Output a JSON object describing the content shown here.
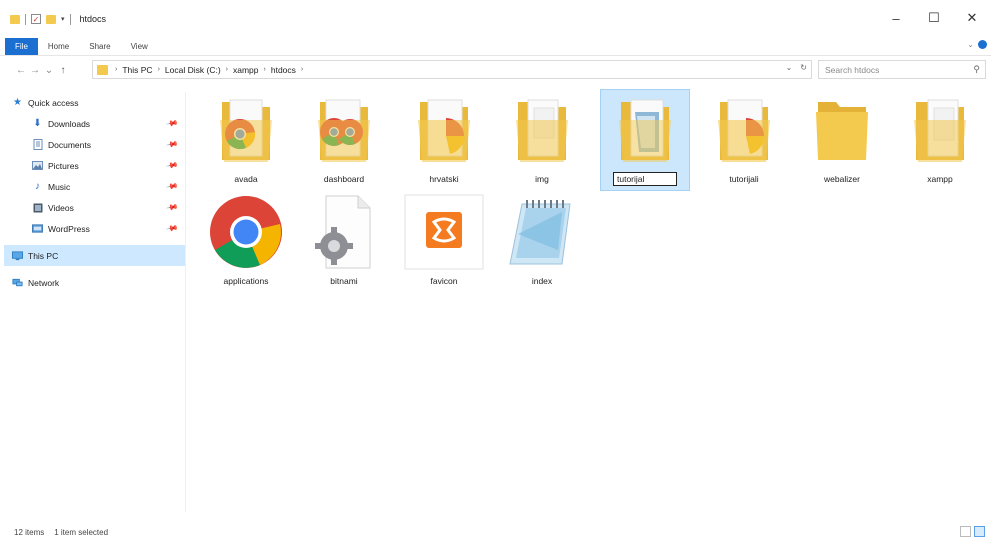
{
  "window": {
    "title": "htdocs"
  },
  "ribbon": {
    "tabs": [
      "File",
      "Home",
      "Share",
      "View"
    ]
  },
  "nav": {
    "back": "←",
    "forward": "→",
    "recent": "⌄",
    "up": "↑"
  },
  "address": {
    "crumbs": [
      "This PC",
      "Local Disk (C:)",
      "xampp",
      "htdocs"
    ]
  },
  "search": {
    "placeholder": "Search htdocs"
  },
  "sidebar": {
    "quick_access": "Quick access",
    "items": [
      {
        "label": "Downloads",
        "icon": "download-icon"
      },
      {
        "label": "Documents",
        "icon": "documents-icon"
      },
      {
        "label": "Pictures",
        "icon": "pictures-icon"
      },
      {
        "label": "Music",
        "icon": "music-icon"
      },
      {
        "label": "Videos",
        "icon": "videos-icon"
      },
      {
        "label": "WordPress",
        "icon": "wordpress-icon"
      }
    ],
    "this_pc": "This PC",
    "network": "Network"
  },
  "files": [
    {
      "name": "avada",
      "type": "folder-chrome"
    },
    {
      "name": "dashboard",
      "type": "folder-chrome"
    },
    {
      "name": "hrvatski",
      "type": "folder-chrome"
    },
    {
      "name": "img",
      "type": "folder-doc"
    },
    {
      "name": "tutorijal",
      "type": "folder-doc",
      "selected": true,
      "renaming": true
    },
    {
      "name": "tutorijali",
      "type": "folder-chrome"
    },
    {
      "name": "webalizer",
      "type": "folder"
    },
    {
      "name": "xampp",
      "type": "folder-doc"
    },
    {
      "name": "applications",
      "type": "chrome"
    },
    {
      "name": "bitnami",
      "type": "settings-file"
    },
    {
      "name": "favicon",
      "type": "xampp-icon"
    },
    {
      "name": "index",
      "type": "notepad"
    }
  ],
  "status": {
    "items_count": "12 items",
    "selected_count": "1 item selected"
  },
  "colors": {
    "accent": "#1a6fd1",
    "selection": "#cce6fb",
    "folder": "#f3c94e"
  }
}
